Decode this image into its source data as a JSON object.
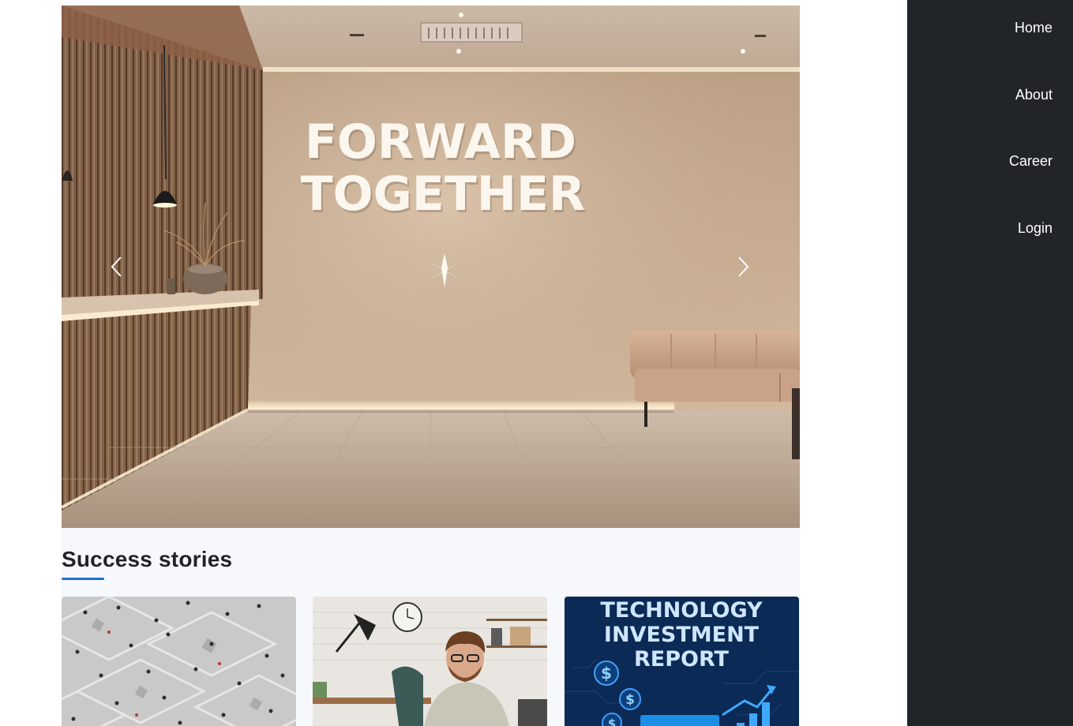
{
  "nav": {
    "items": [
      {
        "label": "Home"
      },
      {
        "label": "About"
      },
      {
        "label": "Career"
      },
      {
        "label": "Login"
      }
    ]
  },
  "hero": {
    "sign_line1": "FORWARD",
    "sign_line2": "TOGETHER",
    "prev_icon": "chevron-left-icon",
    "next_icon": "chevron-right-icon"
  },
  "success_stories": {
    "title": "Success stories",
    "cards": [
      {
        "image": "crowd-plaza-aerial"
      },
      {
        "image": "man-working-desk"
      },
      {
        "image": "technology-investment-report",
        "text_line1": "TECHNOLOGY",
        "text_line2": "INVESTMENT",
        "text_line3": "REPORT"
      }
    ]
  },
  "colors": {
    "sidebar": "#212529",
    "accent": "#1d6fd6",
    "section_bg": "#f6f8fb"
  }
}
